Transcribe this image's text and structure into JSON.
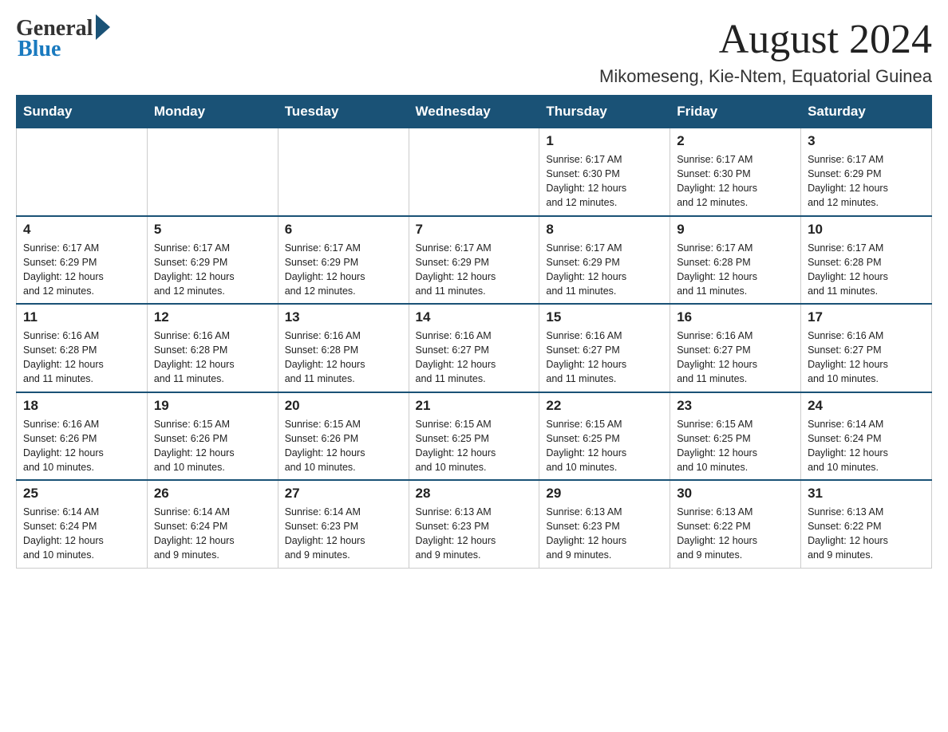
{
  "header": {
    "logo_general": "General",
    "logo_blue": "Blue",
    "month_title": "August 2024",
    "location": "Mikomeseng, Kie-Ntem, Equatorial Guinea"
  },
  "days_of_week": [
    "Sunday",
    "Monday",
    "Tuesday",
    "Wednesday",
    "Thursday",
    "Friday",
    "Saturday"
  ],
  "weeks": [
    [
      {
        "day": "",
        "info": ""
      },
      {
        "day": "",
        "info": ""
      },
      {
        "day": "",
        "info": ""
      },
      {
        "day": "",
        "info": ""
      },
      {
        "day": "1",
        "info": "Sunrise: 6:17 AM\nSunset: 6:30 PM\nDaylight: 12 hours\nand 12 minutes."
      },
      {
        "day": "2",
        "info": "Sunrise: 6:17 AM\nSunset: 6:30 PM\nDaylight: 12 hours\nand 12 minutes."
      },
      {
        "day": "3",
        "info": "Sunrise: 6:17 AM\nSunset: 6:29 PM\nDaylight: 12 hours\nand 12 minutes."
      }
    ],
    [
      {
        "day": "4",
        "info": "Sunrise: 6:17 AM\nSunset: 6:29 PM\nDaylight: 12 hours\nand 12 minutes."
      },
      {
        "day": "5",
        "info": "Sunrise: 6:17 AM\nSunset: 6:29 PM\nDaylight: 12 hours\nand 12 minutes."
      },
      {
        "day": "6",
        "info": "Sunrise: 6:17 AM\nSunset: 6:29 PM\nDaylight: 12 hours\nand 12 minutes."
      },
      {
        "day": "7",
        "info": "Sunrise: 6:17 AM\nSunset: 6:29 PM\nDaylight: 12 hours\nand 11 minutes."
      },
      {
        "day": "8",
        "info": "Sunrise: 6:17 AM\nSunset: 6:29 PM\nDaylight: 12 hours\nand 11 minutes."
      },
      {
        "day": "9",
        "info": "Sunrise: 6:17 AM\nSunset: 6:28 PM\nDaylight: 12 hours\nand 11 minutes."
      },
      {
        "day": "10",
        "info": "Sunrise: 6:17 AM\nSunset: 6:28 PM\nDaylight: 12 hours\nand 11 minutes."
      }
    ],
    [
      {
        "day": "11",
        "info": "Sunrise: 6:16 AM\nSunset: 6:28 PM\nDaylight: 12 hours\nand 11 minutes."
      },
      {
        "day": "12",
        "info": "Sunrise: 6:16 AM\nSunset: 6:28 PM\nDaylight: 12 hours\nand 11 minutes."
      },
      {
        "day": "13",
        "info": "Sunrise: 6:16 AM\nSunset: 6:28 PM\nDaylight: 12 hours\nand 11 minutes."
      },
      {
        "day": "14",
        "info": "Sunrise: 6:16 AM\nSunset: 6:27 PM\nDaylight: 12 hours\nand 11 minutes."
      },
      {
        "day": "15",
        "info": "Sunrise: 6:16 AM\nSunset: 6:27 PM\nDaylight: 12 hours\nand 11 minutes."
      },
      {
        "day": "16",
        "info": "Sunrise: 6:16 AM\nSunset: 6:27 PM\nDaylight: 12 hours\nand 11 minutes."
      },
      {
        "day": "17",
        "info": "Sunrise: 6:16 AM\nSunset: 6:27 PM\nDaylight: 12 hours\nand 10 minutes."
      }
    ],
    [
      {
        "day": "18",
        "info": "Sunrise: 6:16 AM\nSunset: 6:26 PM\nDaylight: 12 hours\nand 10 minutes."
      },
      {
        "day": "19",
        "info": "Sunrise: 6:15 AM\nSunset: 6:26 PM\nDaylight: 12 hours\nand 10 minutes."
      },
      {
        "day": "20",
        "info": "Sunrise: 6:15 AM\nSunset: 6:26 PM\nDaylight: 12 hours\nand 10 minutes."
      },
      {
        "day": "21",
        "info": "Sunrise: 6:15 AM\nSunset: 6:25 PM\nDaylight: 12 hours\nand 10 minutes."
      },
      {
        "day": "22",
        "info": "Sunrise: 6:15 AM\nSunset: 6:25 PM\nDaylight: 12 hours\nand 10 minutes."
      },
      {
        "day": "23",
        "info": "Sunrise: 6:15 AM\nSunset: 6:25 PM\nDaylight: 12 hours\nand 10 minutes."
      },
      {
        "day": "24",
        "info": "Sunrise: 6:14 AM\nSunset: 6:24 PM\nDaylight: 12 hours\nand 10 minutes."
      }
    ],
    [
      {
        "day": "25",
        "info": "Sunrise: 6:14 AM\nSunset: 6:24 PM\nDaylight: 12 hours\nand 10 minutes."
      },
      {
        "day": "26",
        "info": "Sunrise: 6:14 AM\nSunset: 6:24 PM\nDaylight: 12 hours\nand 9 minutes."
      },
      {
        "day": "27",
        "info": "Sunrise: 6:14 AM\nSunset: 6:23 PM\nDaylight: 12 hours\nand 9 minutes."
      },
      {
        "day": "28",
        "info": "Sunrise: 6:13 AM\nSunset: 6:23 PM\nDaylight: 12 hours\nand 9 minutes."
      },
      {
        "day": "29",
        "info": "Sunrise: 6:13 AM\nSunset: 6:23 PM\nDaylight: 12 hours\nand 9 minutes."
      },
      {
        "day": "30",
        "info": "Sunrise: 6:13 AM\nSunset: 6:22 PM\nDaylight: 12 hours\nand 9 minutes."
      },
      {
        "day": "31",
        "info": "Sunrise: 6:13 AM\nSunset: 6:22 PM\nDaylight: 12 hours\nand 9 minutes."
      }
    ]
  ]
}
